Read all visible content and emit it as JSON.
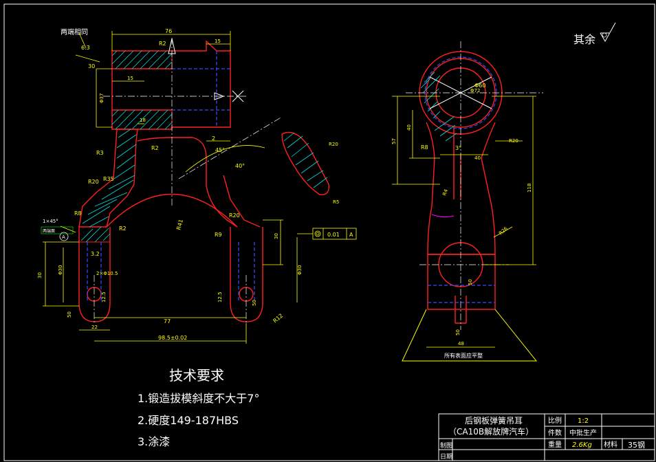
{
  "dimensions_left": {
    "top_width": "76",
    "right_top": "15",
    "both_ends_same": "两端相同",
    "roughness_63": "6.3",
    "dim_30_top": "30",
    "dim_15": "15",
    "dia_37": "Φ37",
    "dim_18": "18",
    "r2_top": "R2",
    "r3": "R3",
    "r2_mid": "R2",
    "r20": "R20",
    "r35": "R35",
    "r8": "R8",
    "r2_low": "R2",
    "chamfer": "1×45°",
    "both_end_faces": "两端面",
    "datum_a": "A",
    "dim_30_left": "30",
    "dia_30_left": "Φ30",
    "dim_32": "3.2",
    "holes": "2×Φ10.5",
    "dim_125_left": "12.5",
    "dim_50_left": "50",
    "dim_22": "22",
    "dim_77": "77",
    "dim_985": "98.5±0.02",
    "r41": "R41",
    "dim_2": "2",
    "angle_45": "45°",
    "angle_40": "40°",
    "r20_sec": "R20",
    "r5_sec": "R5",
    "r20_mid": "R20",
    "r9": "R9",
    "dim_30_right": "30",
    "dia_30_right": "Φ30",
    "tolerance_value": "0.01",
    "tolerance_datum": "A",
    "dim_125_right": "12.5",
    "dim_50_right": "50",
    "r12": "R12"
  },
  "dimensions_right": {
    "dia_72": "Φ72",
    "dia_60": "Φ60",
    "dim_57": "57",
    "dim_40_v": "40",
    "r8": "R8",
    "angle_3": "3°",
    "dim_40_h": "40",
    "r20": "R20",
    "r4": "R4",
    "dim_118": "118",
    "r26": "R26",
    "dim_50": "50",
    "dim_50_low": "50",
    "dim_48": "48",
    "base_note": "所有表面应平整"
  },
  "surface_note": "其余",
  "tech_requirements": {
    "title": "技术要求",
    "items": [
      "1.锻造拔模斜度不大于7°",
      "2.硬度149-187HBS",
      "3.涂漆"
    ]
  },
  "title_block": {
    "part_name_line1": "后钢板弹簧吊耳",
    "part_name_line2": "（CA10B解放牌汽车）",
    "scale_label": "比例",
    "scale_value": "1:2",
    "quantity_label": "件数",
    "quantity_value": "中批生产",
    "weight_label": "重量",
    "weight_value": "2.6Kg",
    "material_label": "材料",
    "material_value": "35钢",
    "drawn_label": "制图",
    "date_label": "日期"
  }
}
